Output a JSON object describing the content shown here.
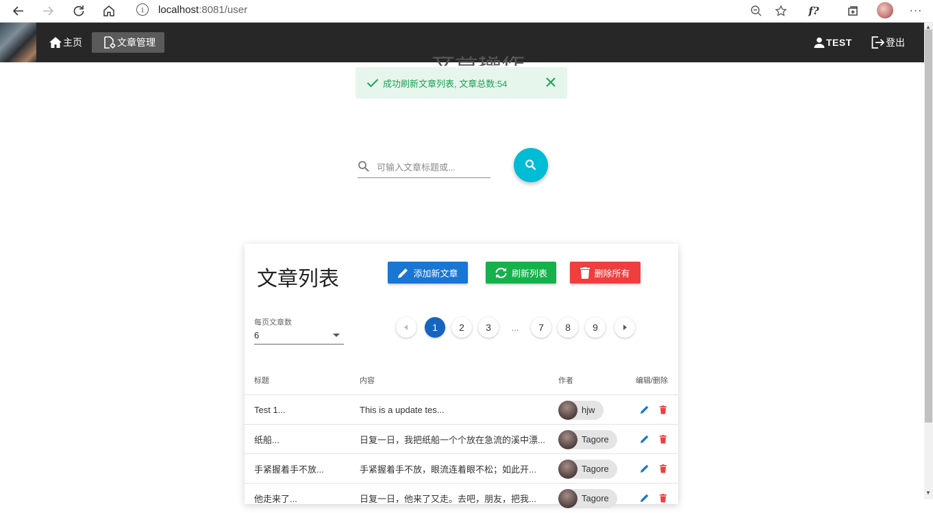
{
  "browser": {
    "url_host": "localhost",
    "url_rest": ":8081/user"
  },
  "nav": {
    "home_label": "主页",
    "articles_label": "文章管理",
    "user_label": "TEST",
    "logout_label": "登出"
  },
  "hidden_heading": "文章操作",
  "alert": {
    "message": "成功刷新文章列表, 文章总数:54",
    "color": "#1aa055"
  },
  "search": {
    "placeholder": "可输入文章标题或..."
  },
  "card": {
    "title": "文章列表",
    "add_button": "添加新文章",
    "refresh_button": "刷新列表",
    "delete_all_button": "删除所有",
    "per_page_label": "每页文章数",
    "per_page_value": "6"
  },
  "pagination": {
    "pages": [
      "1",
      "2",
      "3",
      "...",
      "7",
      "8",
      "9"
    ],
    "current": "1"
  },
  "table": {
    "headers": [
      "标题",
      "内容",
      "作者",
      "编辑/删除"
    ],
    "rows": [
      {
        "title": "Test 1...",
        "content": "This is a update tes...",
        "author": "hjw"
      },
      {
        "title": "纸船...",
        "content": "日复一日，我把纸船一个个放在急流的溪中漂...",
        "author": "Tagore"
      },
      {
        "title": "手紧握着手不放...",
        "content": "手紧握着手不放，眼流连着眼不松；如此开...",
        "author": "Tagore"
      },
      {
        "title": "他走来了...",
        "content": "日复一日，他来了又走。去吧，朋友，把我...",
        "author": "Tagore"
      }
    ]
  },
  "colors": {
    "nav_bg": "#272727",
    "fab": "#00bcd4",
    "add": "#1976d2",
    "refresh": "#15b14b",
    "delete": "#f03e3e",
    "page_active": "#1565c0"
  }
}
